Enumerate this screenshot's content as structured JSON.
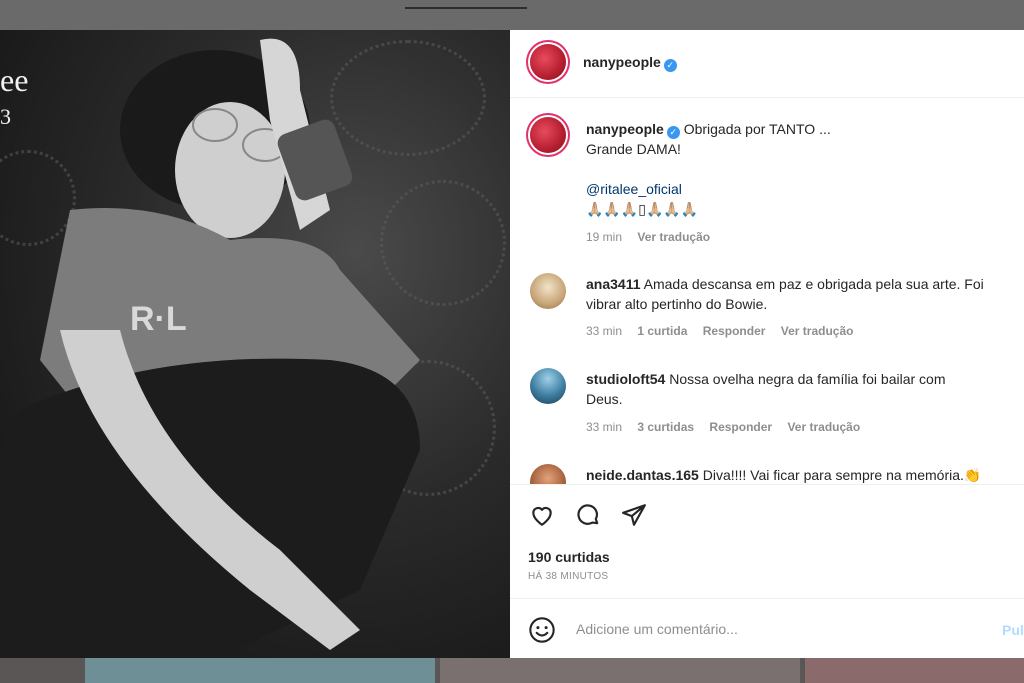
{
  "photo": {
    "overlay_line1": "ee",
    "overlay_line2": "3"
  },
  "post": {
    "author": "nanypeople",
    "caption_line1": "Obrigada por TANTO ...",
    "caption_line2": "Grande DAMA!",
    "mention": "@ritalee_oficial",
    "emojis": "🙏🏼🙏🏼🙏🏼▯🙏🏼🙏🏼🙏🏼",
    "time": "19 min",
    "see_translation": "Ver tradução"
  },
  "comments": [
    {
      "user": "ana3411",
      "text_line1": "Amada descansa em paz e obrigada pela sua arte. Foi",
      "text_line2": "vibrar alto pertinho do Bowie.",
      "time": "33 min",
      "likes": "1 curtida",
      "reply": "Responder",
      "see_translation": "Ver tradução"
    },
    {
      "user": "studioloft54",
      "text_line1": "Nossa ovelha negra da família foi bailar com",
      "text_line2": "Deus.",
      "time": "33 min",
      "likes": "3 curtidas",
      "reply": "Responder",
      "see_translation": "Ver tradução"
    },
    {
      "user": "neide.dantas.165",
      "text_line1": "Diva!!!! Vai ficar para sempre na memória.👏"
    }
  ],
  "actions": {
    "like_icon": "heart-icon",
    "comment_icon": "comment-icon",
    "share_icon": "paper-plane-icon",
    "likes_count": "190 curtidas",
    "time_ago": "HÁ 38 MINUTOS"
  },
  "composer": {
    "emoji_icon": "smiley-icon",
    "placeholder": "Adicione um comentário...",
    "publish_label": "Pul"
  },
  "colors": {
    "verified": "#3897f0",
    "mention": "#00376b",
    "publish_disabled": "#b3dbff",
    "meta_gray": "#8e8e8e"
  }
}
